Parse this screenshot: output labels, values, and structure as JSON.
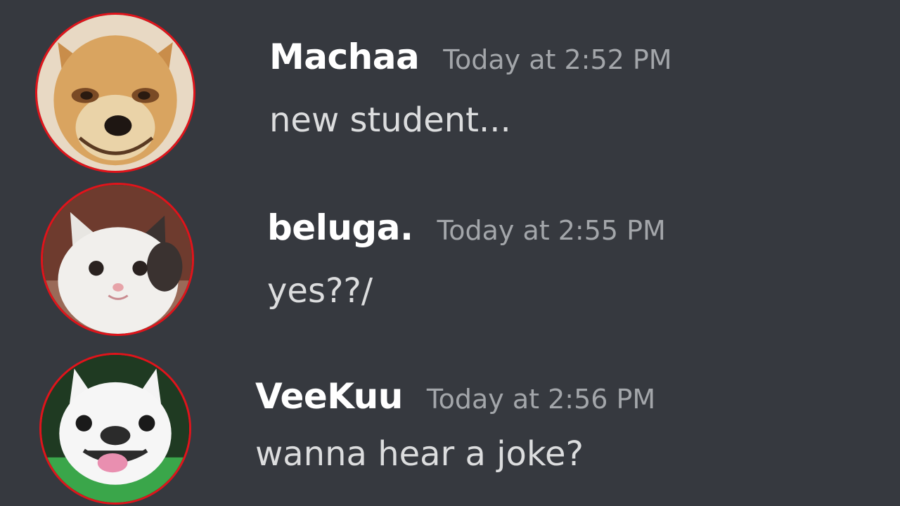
{
  "colors": {
    "background": "#36393f",
    "username": "#ffffff",
    "timestamp": "#a3a6aa",
    "message_text": "#dcddde",
    "avatar_border": "#e0141b"
  },
  "messages": [
    {
      "username": "Machaa",
      "timestamp": "Today at 2:52 PM",
      "text": "new student...",
      "avatar_icon": "smiling-chihuahua-avatar"
    },
    {
      "username": "beluga.",
      "timestamp": "Today at 2:55 PM",
      "text": "yes??/",
      "avatar_icon": "beluga-cat-avatar"
    },
    {
      "username": "VeeKuu",
      "timestamp": "Today at 2:56 PM",
      "text": "wanna hear a joke?",
      "avatar_icon": "french-bulldog-avatar"
    }
  ]
}
